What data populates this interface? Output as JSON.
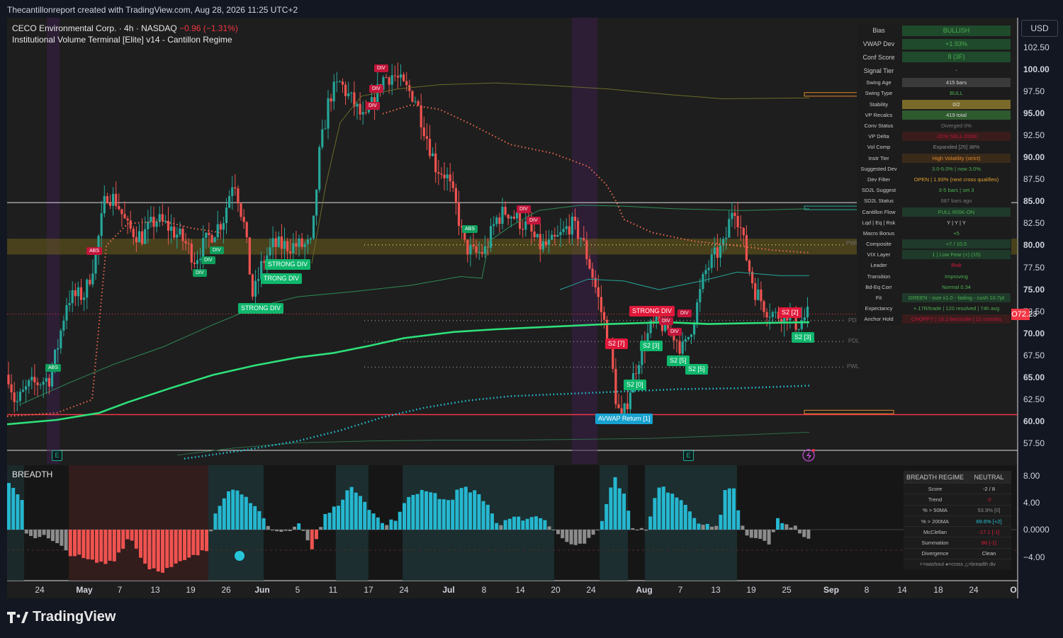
{
  "header": {
    "text": "Thecantillonreport created with TradingView.com, Aug 28, 2026 11:25 UTC+2"
  },
  "legend": {
    "symbol": "CECO Environmental Corp. · 4h · NASDAQ",
    "change": "−0.96 (−1.31%)",
    "indicator": "Institutional Volume Terminal [Elite] v14 - Cantillon Regime"
  },
  "breadth_label": "BREADTH",
  "currency": "USD",
  "price_axis": [
    "102.50",
    "100.00",
    "97.50",
    "95.00",
    "92.50",
    "90.00",
    "87.50",
    "85.00",
    "82.50",
    "80.00",
    "77.50",
    "75.00",
    "72.50",
    "70.00",
    "67.50",
    "65.00",
    "62.50",
    "60.00",
    "57.50"
  ],
  "breadth_axis": [
    "8.00",
    "4.00",
    "0.0000",
    "−4.00"
  ],
  "time_axis": [
    {
      "label": "24",
      "bold": false
    },
    {
      "label": "May",
      "bold": true
    },
    {
      "label": "7",
      "bold": false
    },
    {
      "label": "13",
      "bold": false
    },
    {
      "label": "19",
      "bold": false
    },
    {
      "label": "26",
      "bold": false
    },
    {
      "label": "Jun",
      "bold": true
    },
    {
      "label": "5",
      "bold": false
    },
    {
      "label": "11",
      "bold": false
    },
    {
      "label": "17",
      "bold": false
    },
    {
      "label": "24",
      "bold": false
    },
    {
      "label": "Jul",
      "bold": true
    },
    {
      "label": "8",
      "bold": false
    },
    {
      "label": "14",
      "bold": false
    },
    {
      "label": "20",
      "bold": false
    },
    {
      "label": "24",
      "bold": false
    },
    {
      "label": "Aug",
      "bold": true
    },
    {
      "label": "7",
      "bold": false
    },
    {
      "label": "13",
      "bold": false
    },
    {
      "label": "19",
      "bold": false
    },
    {
      "label": "25",
      "bold": false
    },
    {
      "label": "Sep",
      "bold": true
    },
    {
      "label": "8",
      "bold": false
    },
    {
      "label": "14",
      "bold": false
    },
    {
      "label": "18",
      "bold": false
    },
    {
      "label": "24",
      "bold": false
    },
    {
      "label": "O",
      "bold": true
    }
  ],
  "last_price": {
    "ticker": "CECO",
    "value": "72.23"
  },
  "level_labels": {
    "pwh": "PWH",
    "pdh": "PDH",
    "pdl": "PDL",
    "pwl": "PWL"
  },
  "signal_tags": {
    "strong_div": "STRONG DIV",
    "trong_div": "TRONG DIV",
    "strong_div_2": "STRONG DIV",
    "avwap": "AVWAP Return [1]",
    "s2_7": "S2 [7]",
    "s2_3a": "S2 [3]",
    "s2_5a": "S2 [5]",
    "s2_5b": "S2 [5]",
    "s2_0": "S2 [0]",
    "s2_2": "S2 [2]",
    "s2_3b": "S2 [3]",
    "div": "DIV",
    "abs": "ABS",
    "e": "E"
  },
  "regime_panel": [
    {
      "key": "Bias",
      "value": "BULLISH",
      "bg": "#1f4a2c",
      "fg": "#4caf50",
      "big": true
    },
    {
      "key": "VWAP Dev",
      "value": "+1.93%",
      "bg": "#1f4a2c",
      "fg": "#4caf50",
      "big": true
    },
    {
      "key": "Conf Score",
      "value": "8 (3F)",
      "bg": "#1f4a2c",
      "fg": "#4caf50",
      "big": true
    },
    {
      "key": "Signal Tier",
      "value": "-",
      "bg": "#1c1c1c",
      "fg": "#888888",
      "big": true
    },
    {
      "key": "Swing Age",
      "value": "415 bars",
      "bg": "#3a3a3a",
      "fg": "#d0d0d0",
      "big": false
    },
    {
      "key": "Swing Type",
      "value": "BULL",
      "bg": "#1c1c1c",
      "fg": "#4caf50",
      "big": false
    },
    {
      "key": "Stability",
      "value": "0/2",
      "bg": "#7a6a2a",
      "fg": "#e0e0e0",
      "big": false
    },
    {
      "key": "VP Recalcs",
      "value": "419 total",
      "bg": "#2e5a2e",
      "fg": "#d0d0d0",
      "big": false
    },
    {
      "key": "Conv Status",
      "value": "Diverged 0%",
      "bg": "#1c1c1c",
      "fg": "#777777",
      "big": false
    },
    {
      "key": "VP Delta",
      "value": "-22% SELL DOM",
      "bg": "#3a1c1c",
      "fg": "#c2153a",
      "big": false
    },
    {
      "key": "Vol Comp",
      "value": "Expanded [25] 38%",
      "bg": "#1c1c1c",
      "fg": "#8c8c8c",
      "big": false
    },
    {
      "key": "Instr Tier",
      "value": "High Volatility (strict)",
      "bg": "#3a2a1a",
      "fg": "#e08a2a",
      "big": false
    },
    {
      "key": "Suggested Dev",
      "value": "3.0-5.0% | now 3.0%",
      "bg": "#1c1c1c",
      "fg": "#4caf50",
      "big": false
    },
    {
      "key": "Dev Filter",
      "value": "OPEN | 1.93% (next cross qualifies)",
      "bg": "#1c1c1c",
      "fg": "#e0a030",
      "big": false
    },
    {
      "key": "SD2L Suggest",
      "value": "3-5 bars | set 3",
      "bg": "#1c1c1c",
      "fg": "#4caf50",
      "big": false
    },
    {
      "key": "SD2L Status",
      "value": "687 bars ago",
      "bg": "#1c1c1c",
      "fg": "#777777",
      "big": false
    },
    {
      "key": "Cantillon Flow",
      "value": "FULL RISK-ON",
      "bg": "#1f3a2a",
      "fg": "#4caf50",
      "big": false
    },
    {
      "key": "Lqd | Eq | Rsk",
      "value": "Y | Y | Y",
      "bg": "#1c1c1c",
      "fg": "#d0d0d0",
      "big": false
    },
    {
      "key": "Macro Bonus",
      "value": "+5",
      "bg": "#1c1c1c",
      "fg": "#4caf50",
      "big": false
    },
    {
      "key": "Composite",
      "value": "+7 / 10.5",
      "bg": "#1f3a2a",
      "fg": "#4caf50",
      "big": false
    },
    {
      "key": "VIX Layer",
      "value": "1 | Low Fear (+) (15)",
      "bg": "#1f3a2a",
      "fg": "#4caf50",
      "big": false
    },
    {
      "key": "Leader",
      "value": "Risk",
      "bg": "#1c1c1c",
      "fg": "#e0193a",
      "big": false
    },
    {
      "key": "Transition",
      "value": "Improving",
      "bg": "#1c1c1c",
      "fg": "#4caf50",
      "big": false
    },
    {
      "key": "Bd-Eq Corr",
      "value": "Normal 0.34",
      "bg": "#1c1c1c",
      "fg": "#4caf50",
      "big": false
    },
    {
      "key": "Fit",
      "value": "GREEN - size x1.0 - fading - cush 10.7pt",
      "bg": "#1f3a2a",
      "fg": "#4caf50",
      "big": false
    },
    {
      "key": "Expectancy",
      "value": "+.17R/trade | 120 resolved | 74h avg",
      "bg": "#1c1c1c",
      "fg": "#4caf50",
      "big": false
    },
    {
      "key": "Anchor Hold",
      "value": "CHOPPY | 19.2 bars/side | 12 crosses",
      "bg": "#3a1c1c",
      "fg": "#c2153a",
      "big": false
    }
  ],
  "breadth_panel": {
    "title": "BREADTH REGIME",
    "regime": "NEUTRAL",
    "rows": [
      {
        "key": "Score",
        "value": "-2 / 8",
        "fg": "#c8c8c8"
      },
      {
        "key": "Trend",
        "value": "-2",
        "fg": "#e0193a"
      },
      {
        "key": "% > 50MA",
        "value": "53.9% [0]",
        "fg": "#8c8c8c"
      },
      {
        "key": "% > 200MA",
        "value": "69.6% [+2]",
        "fg": "#26c6da"
      },
      {
        "key": "McClellan",
        "value": "-17.1 [-1]",
        "fg": "#e0193a"
      },
      {
        "key": "Summation",
        "value": "86 [-1]",
        "fg": "#e0193a"
      },
      {
        "key": "Divergence",
        "value": "Clean",
        "fg": "#c8c8c8"
      }
    ],
    "footer": "⚡=washout  ●=cross  △=breadth div"
  },
  "brand": "TradingView",
  "chart_data": {
    "type": "candlestick",
    "price_range": [
      56.5,
      104.5
    ],
    "breadth_range": [
      -8,
      9.5
    ],
    "last_price": 72.23,
    "levels": {
      "pwh": 80.1,
      "pdh": 71.5,
      "pdl": 69.1,
      "pwl": 66.2,
      "support": 60.8,
      "resistance": 84.9,
      "yellow_zone": [
        79.0,
        80.8
      ]
    },
    "bar_count": 278
  }
}
